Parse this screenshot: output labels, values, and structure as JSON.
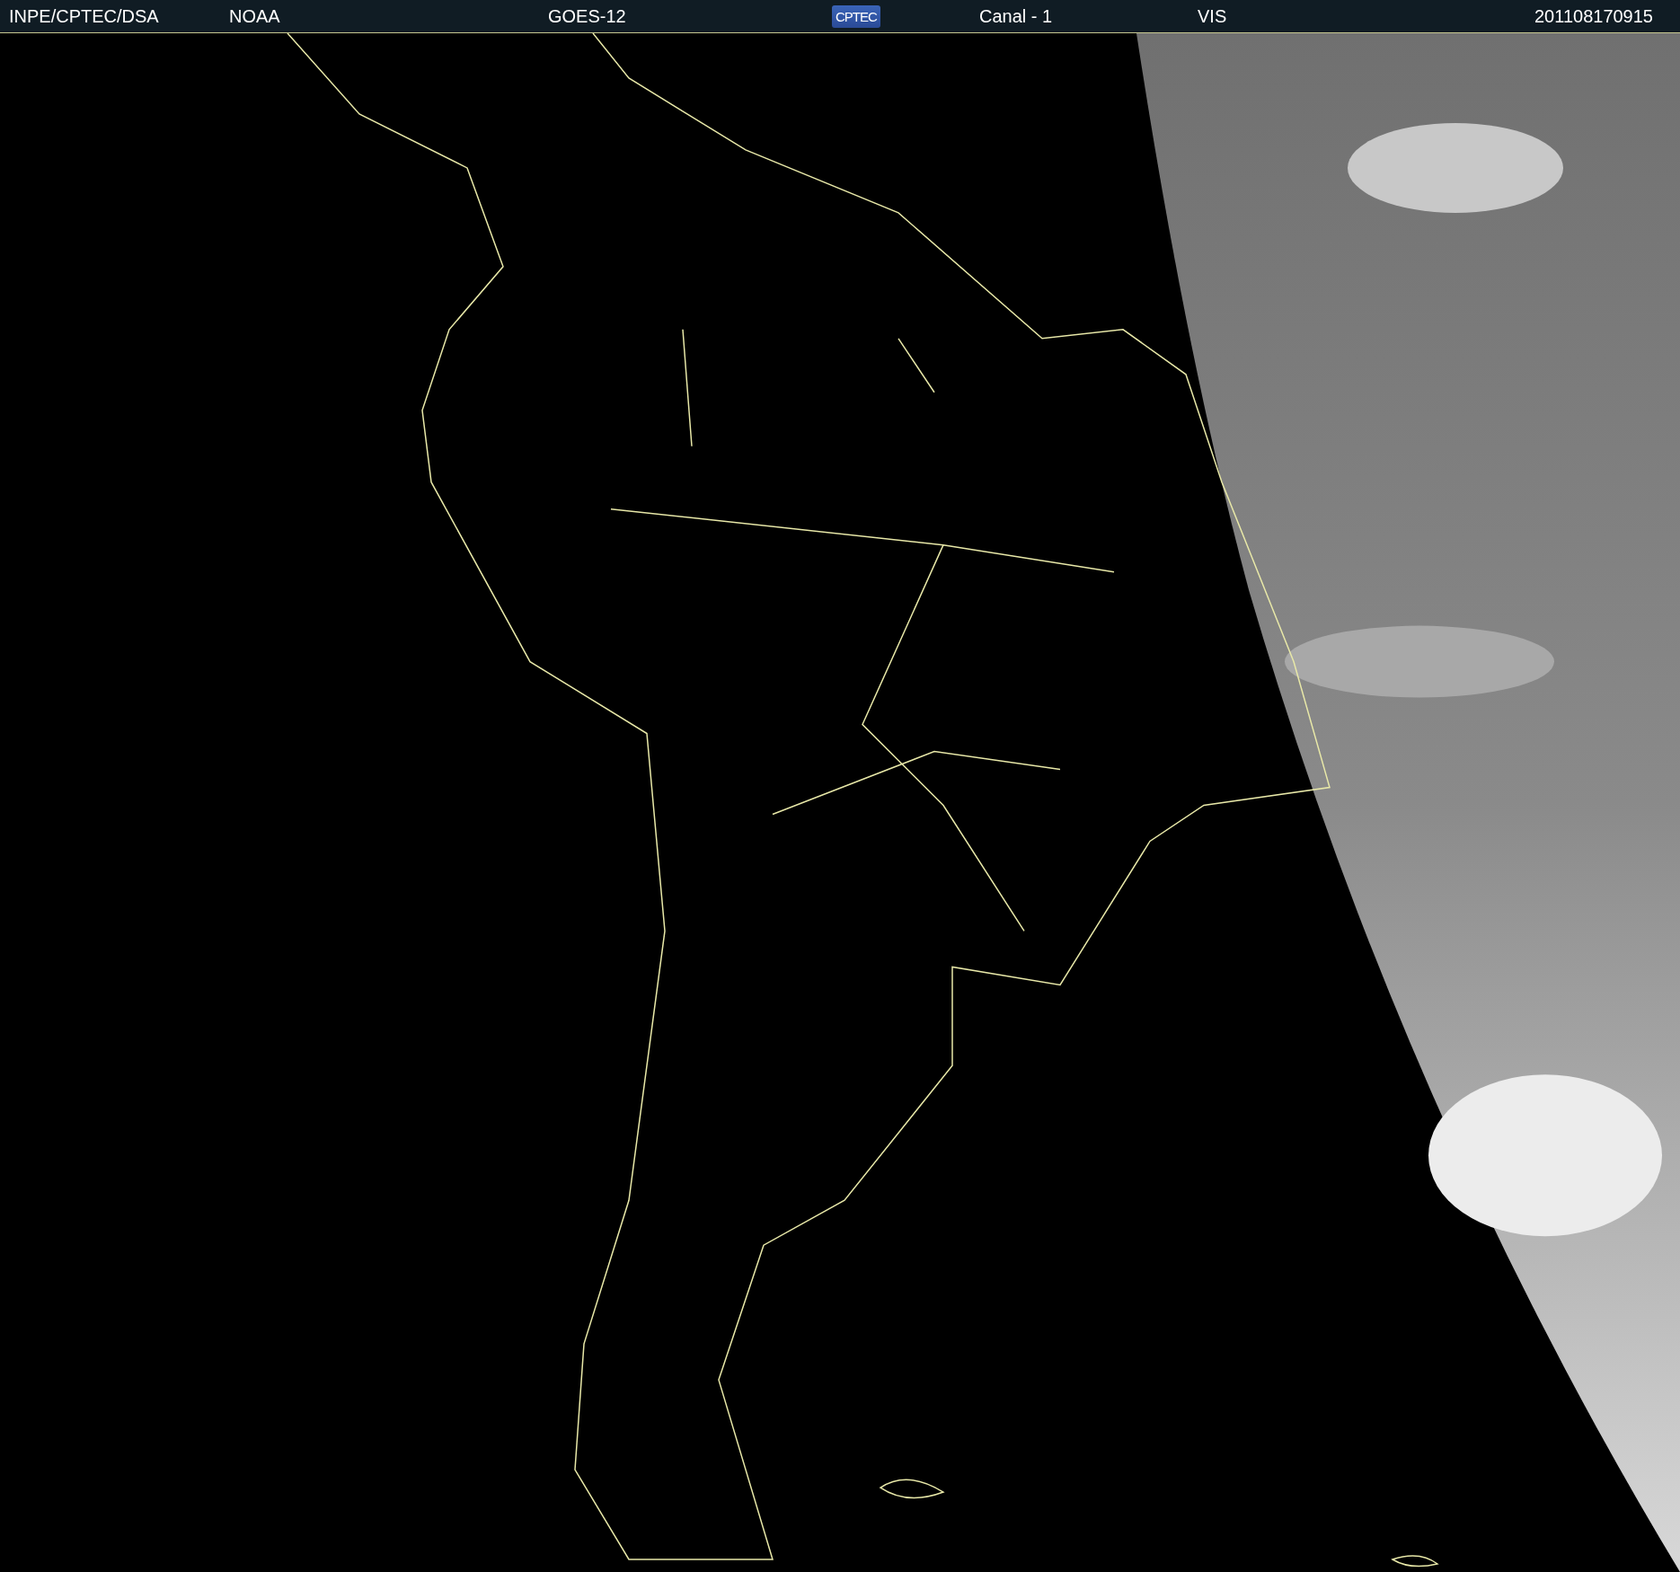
{
  "header": {
    "source": "INPE/CPTEC/DSA",
    "agency": "NOAA",
    "satellite": "GOES-12",
    "logo": "CPTEC",
    "channel": "Canal - 1",
    "band": "VIS",
    "timestamp": "201108170915"
  }
}
